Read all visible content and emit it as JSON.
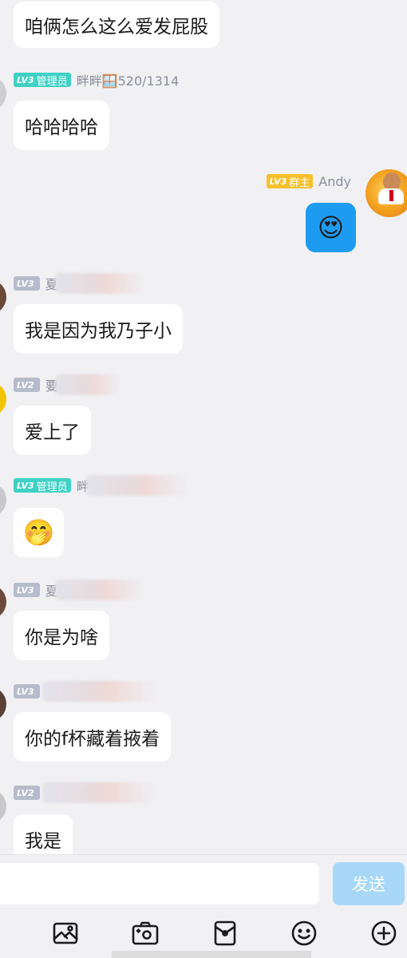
{
  "messages": [
    {
      "side": "left",
      "text": "咱俩怎么这么爱发屁股"
    },
    {
      "side": "left",
      "badge": {
        "lv": "LV3",
        "role": "管理员"
      },
      "name": "畔畔🪟520/1314",
      "text": "哈哈哈哈"
    },
    {
      "side": "right",
      "badge": {
        "lv": "LV3",
        "role": "群主"
      },
      "name": "Andy",
      "emoji": "😍"
    },
    {
      "side": "left",
      "badge": {
        "lv": "LV3",
        "role": ""
      },
      "name": "夏",
      "text": "我是因为我乃子小"
    },
    {
      "side": "left",
      "badge": {
        "lv": "LV2",
        "role": ""
      },
      "name": "要",
      "text": "爱上了"
    },
    {
      "side": "left",
      "badge": {
        "lv": "LV3",
        "role": "管理员"
      },
      "name": "畔",
      "emoji": "🤭"
    },
    {
      "side": "left",
      "badge": {
        "lv": "LV3",
        "role": ""
      },
      "name": "夏",
      "text": "你是为啥"
    },
    {
      "side": "left",
      "badge": {
        "lv": "LV3",
        "role": ""
      },
      "name": "",
      "text": "你的f杯藏着掖着"
    },
    {
      "side": "left",
      "badge": {
        "lv": "LV2",
        "role": ""
      },
      "name": "",
      "text": "我是"
    }
  ],
  "composer": {
    "placeholder": "",
    "send_label": "发送"
  },
  "toolbar": [
    "image-icon",
    "camera-icon",
    "red-packet-icon",
    "emoji-icon",
    "plus-icon"
  ],
  "colors": {
    "background": "#f1f1f4",
    "admin_badge": "#3fd1c4",
    "owner_badge": "#f7c02b",
    "plain_badge": "#b6bccb",
    "my_bubble": "#1d9bf0",
    "send_button": "#a8d8f8"
  }
}
